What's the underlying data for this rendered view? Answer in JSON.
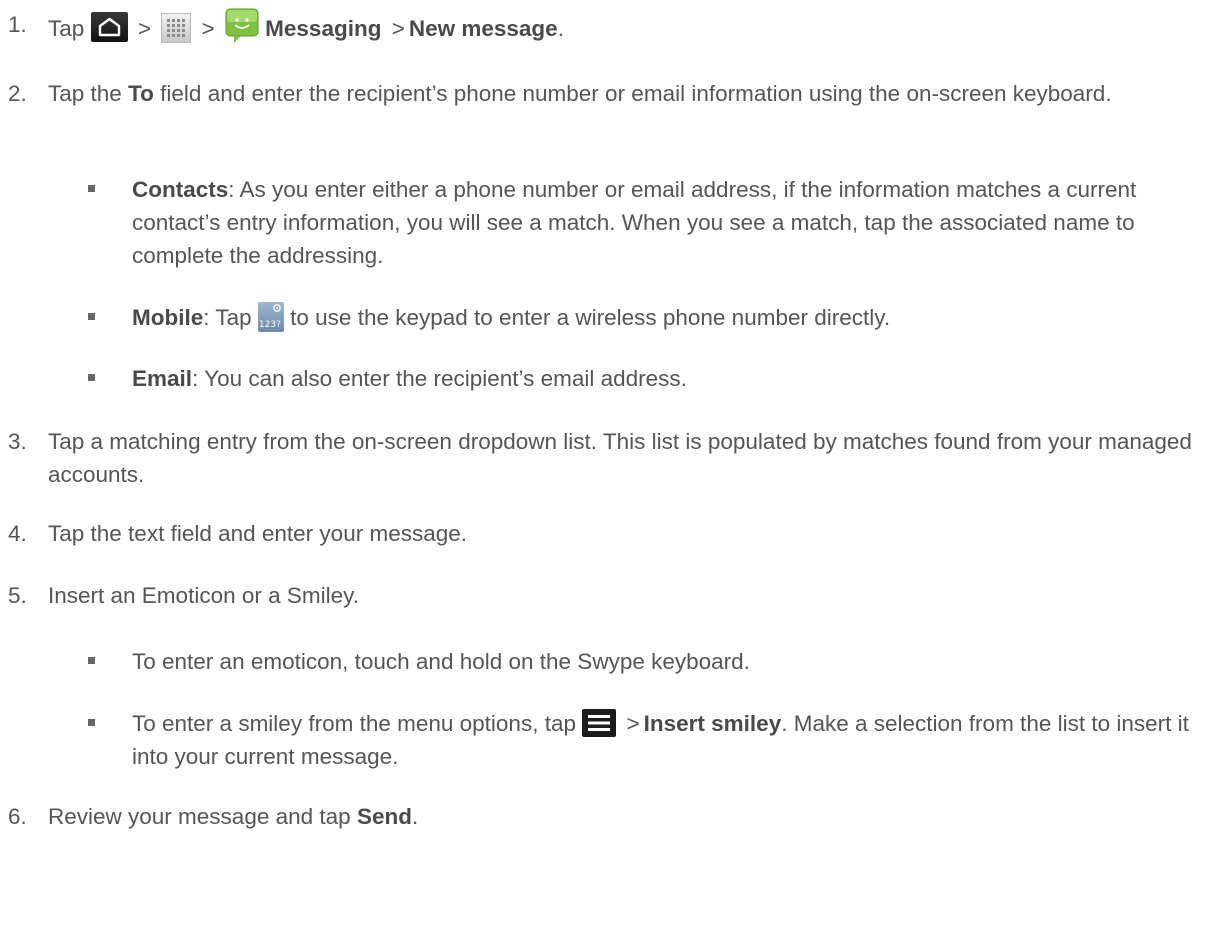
{
  "steps": [
    {
      "num": "1.",
      "tap": "Tap",
      "sep": ">",
      "messaging": "Messaging",
      "new_message": "New message",
      "end": "."
    },
    {
      "num": "2.",
      "pre": "Tap the",
      "to": "To",
      "post": "field and enter the recipient’s phone number or email information using the on-screen keyboard."
    },
    {
      "num": "3.",
      "text": "Tap a matching entry from the on-screen dropdown list. This list is populated by matches found from your managed accounts."
    },
    {
      "num": "4.",
      "text": "Tap the text field and enter your message."
    },
    {
      "num": "5.",
      "text": "Insert an Emoticon or a Smiley."
    },
    {
      "num": "6.",
      "pre": "Review your message and tap",
      "send": "Send",
      "end": "."
    }
  ],
  "step2_bullets": {
    "contacts_label": "Contacts",
    "contacts_text": ": As you enter either a phone number or email address, if the information matches a current contact’s entry information, you will see a match. When you see a match, tap the associated name to complete the addressing.",
    "mobile_label": "Mobile",
    "mobile_pre": ": Tap",
    "mobile_post": "to use the keypad to enter a wireless phone number directly.",
    "keypad_icon_text": "123?",
    "email_label": "Email",
    "email_text": ": You can also enter the recipient’s email address."
  },
  "step5_bullets": {
    "emoticon_text": "To enter an emoticon, touch and hold on the Swype keyboard.",
    "smiley_pre": "To enter a smiley from the menu options, tap",
    "smiley_sep": ">",
    "insert_smiley": "Insert smiley",
    "smiley_post": ". Make a selection from the list to insert it into your current message."
  },
  "icons": {
    "home": "home-icon",
    "apps": "apps-icon",
    "messaging": "messaging-icon",
    "keypad": "keypad-icon",
    "menu": "menu-icon"
  },
  "colors": {
    "text": "#555555",
    "messaging_green": "#7ec242"
  }
}
